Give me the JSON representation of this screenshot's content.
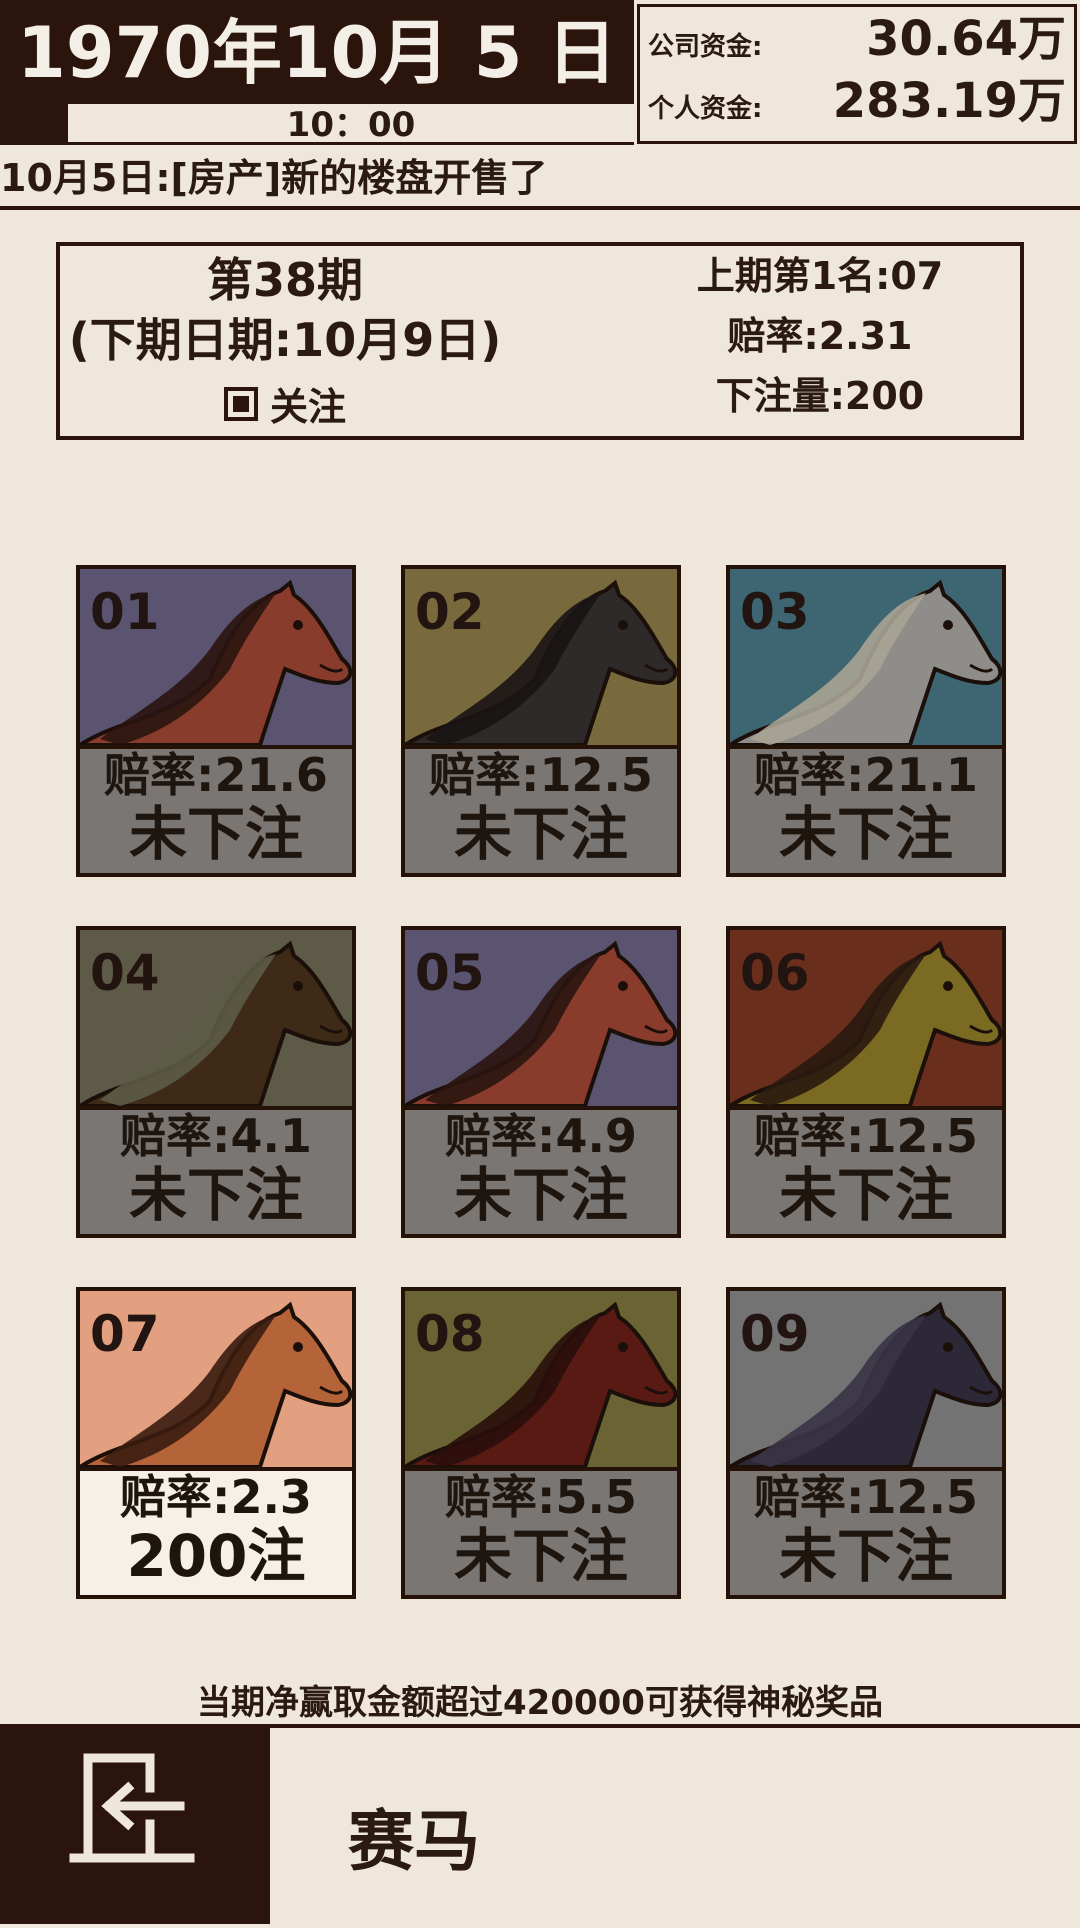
{
  "header": {
    "date": "1970年10月 5 日",
    "time": "10：00",
    "company_funds_label": "公司资金:",
    "company_funds": "30.64万",
    "personal_funds_label": "个人资金:",
    "personal_funds": "283.19万"
  },
  "news": "10月5日:[房产]新的楼盘开售了",
  "period": {
    "title": "第38期",
    "next_date": "(下期日期:10月9日)",
    "follow_label": "关注",
    "follow_checked": true,
    "last_winner": "上期第1名:07",
    "last_odds": "赔率:2.31",
    "last_bets": "下注量:200"
  },
  "horses": [
    {
      "num": "01",
      "odds": "赔率:21.6",
      "bet": "未下注",
      "bg": "#5b5470",
      "coat": "#8a3c2c",
      "mane": "#2a1410",
      "selected": false
    },
    {
      "num": "02",
      "odds": "赔率:12.5",
      "bet": "未下注",
      "bg": "#786a3c",
      "coat": "#2e2a2a",
      "mane": "#1a1414",
      "selected": false
    },
    {
      "num": "03",
      "odds": "赔率:21.1",
      "bet": "未下注",
      "bg": "#3d6672",
      "coat": "#8f8d8a",
      "mane": "#a7a394",
      "selected": false
    },
    {
      "num": "04",
      "odds": "赔率:4.1",
      "bet": "未下注",
      "bg": "#5e5a48",
      "coat": "#3f2a18",
      "mane": "#5c5b46",
      "selected": false
    },
    {
      "num": "05",
      "odds": "赔率:4.9",
      "bet": "未下注",
      "bg": "#5b5470",
      "coat": "#8a3c2c",
      "mane": "#2a1410",
      "selected": false
    },
    {
      "num": "06",
      "odds": "赔率:12.5",
      "bet": "未下注",
      "bg": "#6a2e1c",
      "coat": "#7a6a22",
      "mane": "#2a1a10",
      "selected": false
    },
    {
      "num": "07",
      "odds": "赔率:2.3",
      "bet": "200注",
      "bg": "#e2a080",
      "coat": "#b46438",
      "mane": "#3a1c10",
      "selected": true
    },
    {
      "num": "08",
      "odds": "赔率:5.5",
      "bet": "未下注",
      "bg": "#6a6434",
      "coat": "#5a1a14",
      "mane": "#2a0e0a",
      "selected": false
    },
    {
      "num": "09",
      "odds": "赔率:12.5",
      "bet": "未下注",
      "bg": "#737373",
      "coat": "#2c2838",
      "mane": "#3a3446",
      "selected": false
    }
  ],
  "promo": "当期净赢取金额超过420000可获得神秘奖品",
  "footer": {
    "title": "赛马",
    "exit_icon": "exit-door-icon"
  }
}
